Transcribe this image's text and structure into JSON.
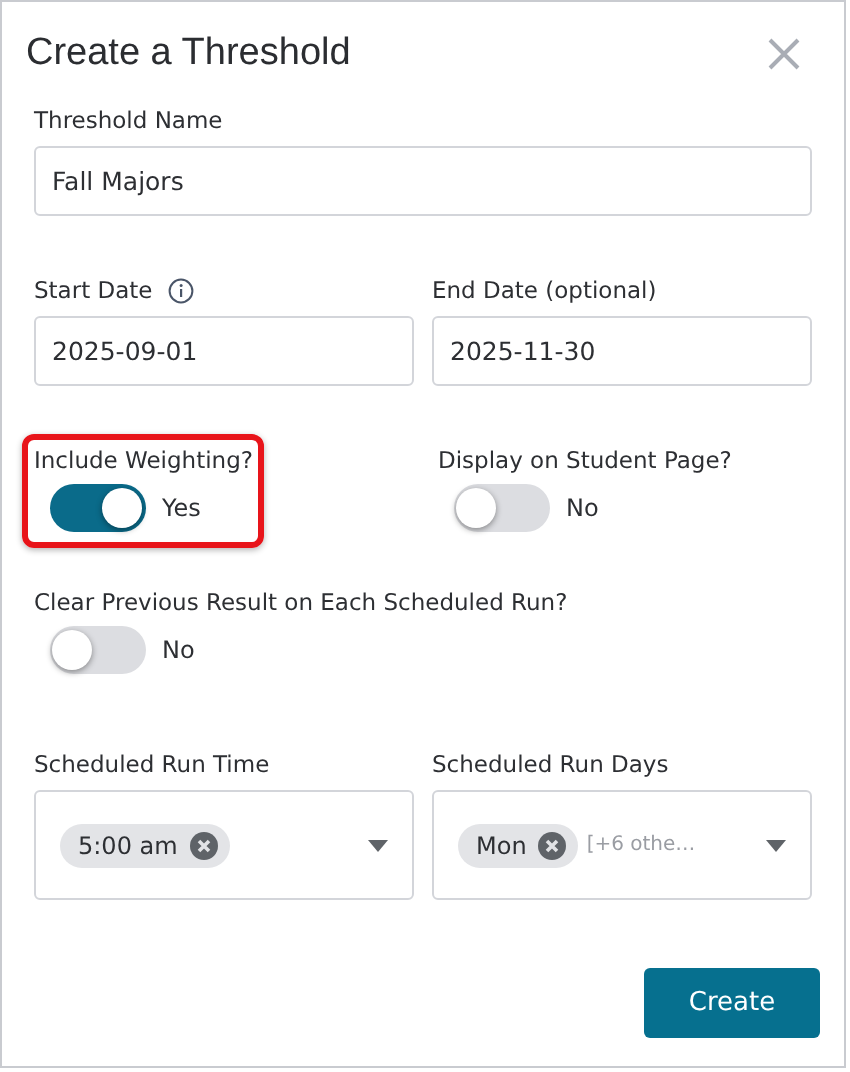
{
  "dialog": {
    "title": "Create a Threshold"
  },
  "name_field": {
    "label": "Threshold Name",
    "value": "Fall Majors"
  },
  "date_fields": [
    {
      "label": "Start Date",
      "value": "2025-09-01",
      "kind": "info"
    },
    {
      "label": "End Date (optional)",
      "value": "2025-11-30",
      "kind": "plain"
    }
  ],
  "toggles": [
    {
      "label": "Include Weighting?",
      "on": true,
      "state_text": "Yes",
      "highlighted": true
    },
    {
      "label": "Display on Student Page?",
      "on": false,
      "state_text": "No",
      "highlighted": false
    },
    {
      "label": "Clear Previous Result on Each Scheduled Run?",
      "on": false,
      "state_text": "No",
      "highlighted": false
    }
  ],
  "selects": [
    {
      "label": "Scheduled Run Time",
      "chips": [
        "5:00 am"
      ]
    },
    {
      "label": "Scheduled Run Days",
      "chips": [
        "Mon"
      ],
      "more": "[+6 othe…"
    }
  ],
  "submit_button": "Create"
}
